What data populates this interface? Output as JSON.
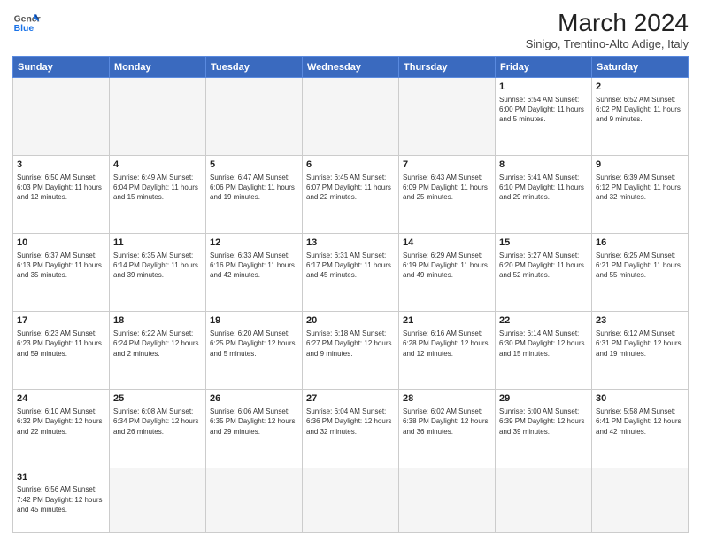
{
  "header": {
    "logo_general": "General",
    "logo_blue": "Blue",
    "title": "March 2024",
    "subtitle": "Sinigo, Trentino-Alto Adige, Italy"
  },
  "weekdays": [
    "Sunday",
    "Monday",
    "Tuesday",
    "Wednesday",
    "Thursday",
    "Friday",
    "Saturday"
  ],
  "weeks": [
    [
      {
        "day": "",
        "info": ""
      },
      {
        "day": "",
        "info": ""
      },
      {
        "day": "",
        "info": ""
      },
      {
        "day": "",
        "info": ""
      },
      {
        "day": "",
        "info": ""
      },
      {
        "day": "1",
        "info": "Sunrise: 6:54 AM\nSunset: 6:00 PM\nDaylight: 11 hours\nand 5 minutes."
      },
      {
        "day": "2",
        "info": "Sunrise: 6:52 AM\nSunset: 6:02 PM\nDaylight: 11 hours\nand 9 minutes."
      }
    ],
    [
      {
        "day": "3",
        "info": "Sunrise: 6:50 AM\nSunset: 6:03 PM\nDaylight: 11 hours\nand 12 minutes."
      },
      {
        "day": "4",
        "info": "Sunrise: 6:49 AM\nSunset: 6:04 PM\nDaylight: 11 hours\nand 15 minutes."
      },
      {
        "day": "5",
        "info": "Sunrise: 6:47 AM\nSunset: 6:06 PM\nDaylight: 11 hours\nand 19 minutes."
      },
      {
        "day": "6",
        "info": "Sunrise: 6:45 AM\nSunset: 6:07 PM\nDaylight: 11 hours\nand 22 minutes."
      },
      {
        "day": "7",
        "info": "Sunrise: 6:43 AM\nSunset: 6:09 PM\nDaylight: 11 hours\nand 25 minutes."
      },
      {
        "day": "8",
        "info": "Sunrise: 6:41 AM\nSunset: 6:10 PM\nDaylight: 11 hours\nand 29 minutes."
      },
      {
        "day": "9",
        "info": "Sunrise: 6:39 AM\nSunset: 6:12 PM\nDaylight: 11 hours\nand 32 minutes."
      }
    ],
    [
      {
        "day": "10",
        "info": "Sunrise: 6:37 AM\nSunset: 6:13 PM\nDaylight: 11 hours\nand 35 minutes."
      },
      {
        "day": "11",
        "info": "Sunrise: 6:35 AM\nSunset: 6:14 PM\nDaylight: 11 hours\nand 39 minutes."
      },
      {
        "day": "12",
        "info": "Sunrise: 6:33 AM\nSunset: 6:16 PM\nDaylight: 11 hours\nand 42 minutes."
      },
      {
        "day": "13",
        "info": "Sunrise: 6:31 AM\nSunset: 6:17 PM\nDaylight: 11 hours\nand 45 minutes."
      },
      {
        "day": "14",
        "info": "Sunrise: 6:29 AM\nSunset: 6:19 PM\nDaylight: 11 hours\nand 49 minutes."
      },
      {
        "day": "15",
        "info": "Sunrise: 6:27 AM\nSunset: 6:20 PM\nDaylight: 11 hours\nand 52 minutes."
      },
      {
        "day": "16",
        "info": "Sunrise: 6:25 AM\nSunset: 6:21 PM\nDaylight: 11 hours\nand 55 minutes."
      }
    ],
    [
      {
        "day": "17",
        "info": "Sunrise: 6:23 AM\nSunset: 6:23 PM\nDaylight: 11 hours\nand 59 minutes."
      },
      {
        "day": "18",
        "info": "Sunrise: 6:22 AM\nSunset: 6:24 PM\nDaylight: 12 hours\nand 2 minutes."
      },
      {
        "day": "19",
        "info": "Sunrise: 6:20 AM\nSunset: 6:25 PM\nDaylight: 12 hours\nand 5 minutes."
      },
      {
        "day": "20",
        "info": "Sunrise: 6:18 AM\nSunset: 6:27 PM\nDaylight: 12 hours\nand 9 minutes."
      },
      {
        "day": "21",
        "info": "Sunrise: 6:16 AM\nSunset: 6:28 PM\nDaylight: 12 hours\nand 12 minutes."
      },
      {
        "day": "22",
        "info": "Sunrise: 6:14 AM\nSunset: 6:30 PM\nDaylight: 12 hours\nand 15 minutes."
      },
      {
        "day": "23",
        "info": "Sunrise: 6:12 AM\nSunset: 6:31 PM\nDaylight: 12 hours\nand 19 minutes."
      }
    ],
    [
      {
        "day": "24",
        "info": "Sunrise: 6:10 AM\nSunset: 6:32 PM\nDaylight: 12 hours\nand 22 minutes."
      },
      {
        "day": "25",
        "info": "Sunrise: 6:08 AM\nSunset: 6:34 PM\nDaylight: 12 hours\nand 26 minutes."
      },
      {
        "day": "26",
        "info": "Sunrise: 6:06 AM\nSunset: 6:35 PM\nDaylight: 12 hours\nand 29 minutes."
      },
      {
        "day": "27",
        "info": "Sunrise: 6:04 AM\nSunset: 6:36 PM\nDaylight: 12 hours\nand 32 minutes."
      },
      {
        "day": "28",
        "info": "Sunrise: 6:02 AM\nSunset: 6:38 PM\nDaylight: 12 hours\nand 36 minutes."
      },
      {
        "day": "29",
        "info": "Sunrise: 6:00 AM\nSunset: 6:39 PM\nDaylight: 12 hours\nand 39 minutes."
      },
      {
        "day": "30",
        "info": "Sunrise: 5:58 AM\nSunset: 6:41 PM\nDaylight: 12 hours\nand 42 minutes."
      }
    ],
    [
      {
        "day": "31",
        "info": "Sunrise: 6:56 AM\nSunset: 7:42 PM\nDaylight: 12 hours\nand 45 minutes."
      },
      {
        "day": "",
        "info": ""
      },
      {
        "day": "",
        "info": ""
      },
      {
        "day": "",
        "info": ""
      },
      {
        "day": "",
        "info": ""
      },
      {
        "day": "",
        "info": ""
      },
      {
        "day": "",
        "info": ""
      }
    ]
  ]
}
